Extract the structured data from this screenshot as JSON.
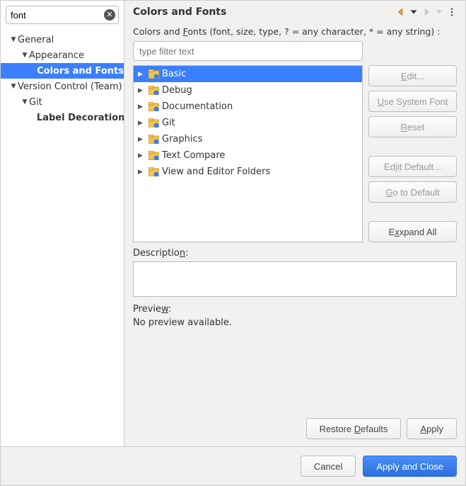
{
  "search": {
    "value": "font"
  },
  "title": "Colors and Fonts",
  "hint_pre": "Colors and ",
  "hint_u": "F",
  "hint_post": "onts (font, size, type, ? = any character, * = any string) :",
  "filter_placeholder": "type filter text",
  "nav": {
    "general": "General",
    "appearance": "Appearance",
    "colors_fonts": "Colors and Fonts",
    "version_control": "Version Control (Team)",
    "git": "Git",
    "label_decorations": "Label Decorations"
  },
  "categories": [
    "Basic",
    "Debug",
    "Documentation",
    "Git",
    "Graphics",
    "Text Compare",
    "View and Editor Folders"
  ],
  "buttons": {
    "edit": "dit...",
    "use_system": "se System Font",
    "reset": "eset",
    "edit_default": "it Default...",
    "go_default": "o to Default",
    "expand_all": "xpand All",
    "restore_defaults_pre": "Restore ",
    "restore_defaults_post": "efaults",
    "apply": "pply",
    "cancel": "Cancel",
    "apply_close": "Apply and Close"
  },
  "description_label_pre": "Descriptio",
  "description_label_post": ":",
  "preview_label_pre": "Previe",
  "preview_label_post": ":",
  "preview_text": "No preview available."
}
